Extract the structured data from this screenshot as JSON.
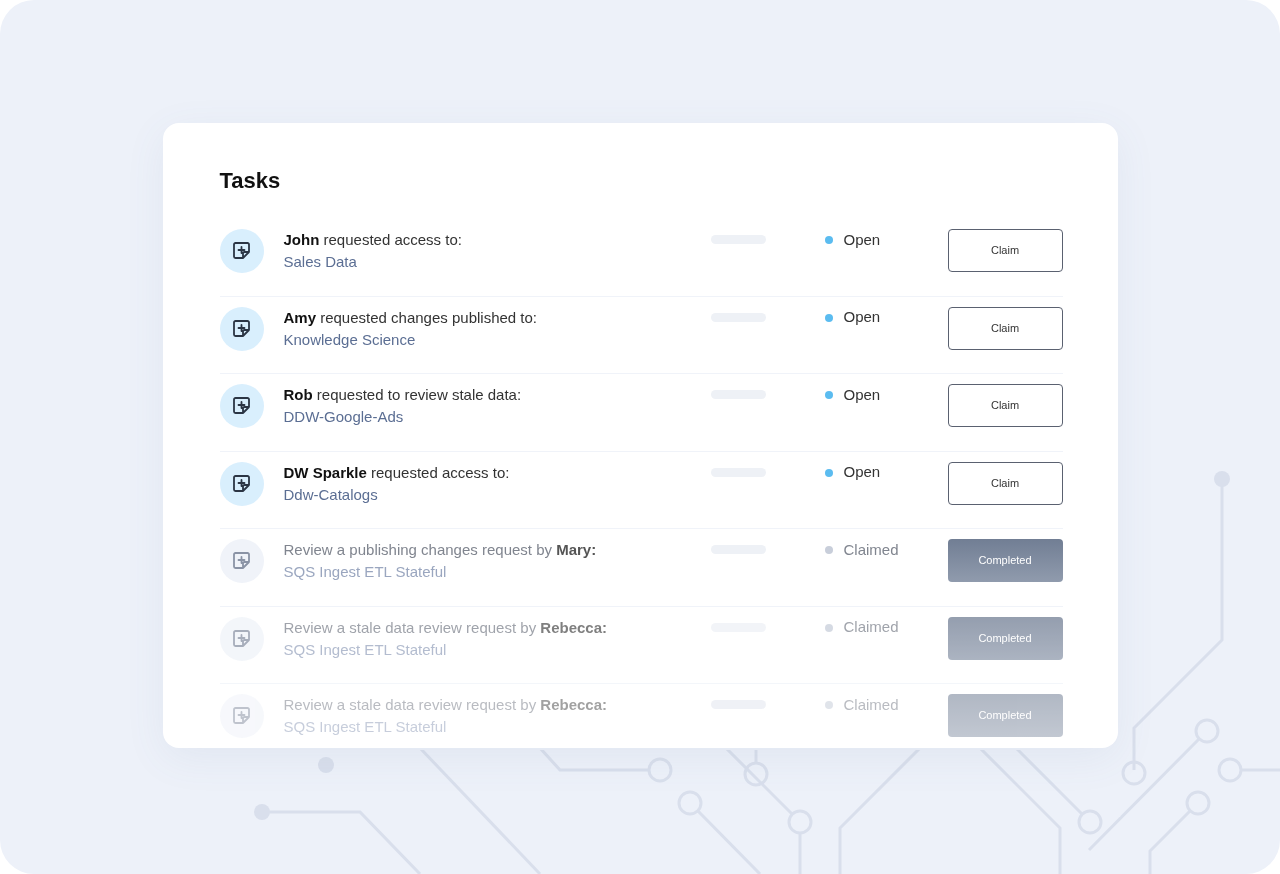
{
  "title": "Tasks",
  "tasks": [
    {
      "kind": "open",
      "description": "**John** requested access to:",
      "target": "Sales Data",
      "status": "Open",
      "action": "Claim"
    },
    {
      "kind": "open",
      "description": "**Amy** requested changes published to:",
      "target": "Knowledge Science",
      "status": "Open",
      "action": "Claim"
    },
    {
      "kind": "open",
      "description": "**Rob** requested to review stale data:",
      "target": "DDW-Google-Ads",
      "status": "Open",
      "action": "Claim"
    },
    {
      "kind": "open",
      "description": "**DW Sparkle** requested access to:",
      "target": "Ddw-Catalogs",
      "status": "Open",
      "action": "Claim"
    },
    {
      "kind": "claimed",
      "description": "Review a publishing changes request by **Mary:**",
      "target": "SQS Ingest ETL Stateful",
      "status": "Claimed",
      "action": "Completed"
    },
    {
      "kind": "claimed",
      "description": "Review a stale data review request by **Rebecca:**",
      "target": "SQS Ingest ETL Stateful",
      "status": "Claimed",
      "action": "Completed"
    },
    {
      "kind": "claimed",
      "description": "Review a stale data review request by **Rebecca:**",
      "target": "SQS Ingest ETL Stateful",
      "status": "Claimed",
      "action": "Completed"
    }
  ]
}
